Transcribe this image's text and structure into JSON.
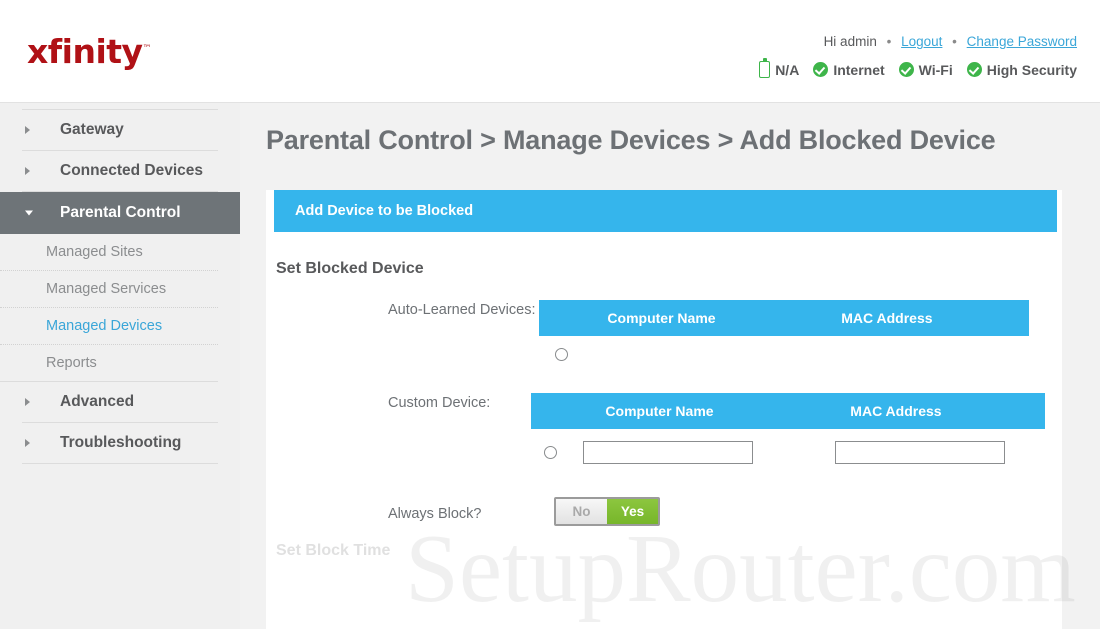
{
  "header": {
    "logo_text": "xfinity",
    "logo_tm": "™",
    "greeting": "Hi admin",
    "separator": "•",
    "logout_label": "Logout",
    "change_password_label": "Change Password",
    "brand_color": "#b01116",
    "status": [
      {
        "icon": "battery-icon",
        "label": "N/A"
      },
      {
        "icon": "check-circle-icon",
        "label": "Internet"
      },
      {
        "icon": "check-circle-icon",
        "label": "Wi-Fi"
      },
      {
        "icon": "check-circle-icon",
        "label": "High Security"
      }
    ],
    "status_color": "#3eb54a"
  },
  "sidebar": {
    "items": [
      {
        "label": "Gateway",
        "state": "collapsed",
        "icon": "chevron-right-icon"
      },
      {
        "label": "Connected Devices",
        "state": "collapsed",
        "icon": "chevron-right-icon"
      },
      {
        "label": "Parental Control",
        "state": "expanded",
        "icon": "chevron-down-icon"
      }
    ],
    "sub_items": [
      {
        "label": "Managed Sites",
        "selected": false
      },
      {
        "label": "Managed Services",
        "selected": false
      },
      {
        "label": "Managed Devices",
        "selected": true
      },
      {
        "label": "Reports",
        "selected": false
      }
    ],
    "items_after": [
      {
        "label": "Advanced",
        "state": "collapsed",
        "icon": "chevron-right-icon"
      },
      {
        "label": "Troubleshooting",
        "state": "collapsed",
        "icon": "chevron-right-icon"
      }
    ],
    "active_bg": "#6e7478",
    "selected_color": "#3aa6d8"
  },
  "main": {
    "page_title": "Parental Control > Manage Devices > Add Blocked Device",
    "panel_header": "Add Device to be Blocked",
    "section_title": "Set Blocked Device",
    "accent_blue": "#35b5ec",
    "auto_learned": {
      "label": "Auto-Learned Devices:",
      "columns": [
        "Computer Name",
        "MAC Address"
      ],
      "rows": [
        {
          "selected": false,
          "computer_name": "",
          "mac_address": ""
        }
      ]
    },
    "custom_device": {
      "label": "Custom Device:",
      "columns": [
        "Computer Name",
        "MAC Address"
      ],
      "rows": [
        {
          "selected": false,
          "computer_name": "",
          "mac_address": ""
        }
      ]
    },
    "always_block": {
      "label": "Always Block?",
      "options": [
        "No",
        "Yes"
      ],
      "selected": "Yes",
      "off_label": "No",
      "on_label": "Yes",
      "on_color": "#8cc63f"
    },
    "block_time_title": "Set Block Time"
  },
  "watermark": {
    "text": "SetupRouter.com"
  }
}
